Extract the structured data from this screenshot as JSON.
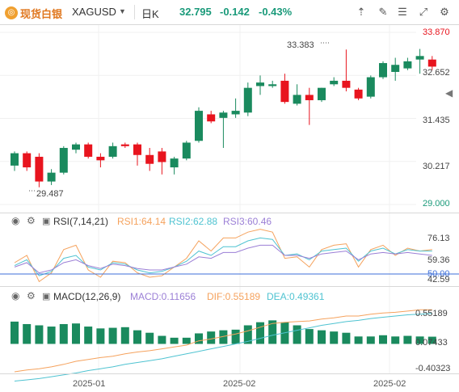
{
  "header": {
    "brand": "现货白银",
    "symbol": "XAGUSD",
    "period": "日K",
    "price": "32.795",
    "change": "-0.142",
    "change_pct": "-0.43%",
    "icons": [
      "arrow-up-icon",
      "edit-icon",
      "list-icon",
      "expand-icon",
      "settings-icon"
    ]
  },
  "main_axis": [
    "33.870",
    "32.652",
    "31.435",
    "30.217",
    "29.000"
  ],
  "annotations": {
    "high": "33.383",
    "low": "29.487"
  },
  "rsi": {
    "title": "RSI(7,14,21)",
    "rsi1": "RSI1:64.14",
    "rsi2": "RSI2:62.88",
    "rsi3": "RSI3:60.46",
    "axis": [
      "76.13",
      "59.36",
      "50.00",
      "42.59"
    ]
  },
  "macd": {
    "title": "MACD(12,26,9)",
    "macd": "MACD:0.11656",
    "dif": "DIF:0.55189",
    "dea": "DEA:0.49361",
    "axis": [
      "0.55189",
      "0.07433",
      "-0.40323"
    ]
  },
  "x_axis": [
    "2025-01",
    "2025-02",
    "2025-02"
  ],
  "colors": {
    "up": "#1a8a5e",
    "down": "#e8141e",
    "rsi1": "#f5a25d",
    "rsi2": "#4fc3d1",
    "rsi3": "#9b7fd6",
    "dif": "#f5a25d",
    "dea": "#4fc3d1"
  },
  "chart_data": {
    "type": "candlestick",
    "ylim": [
      29.0,
      33.87
    ],
    "candles": [
      {
        "o": 30.1,
        "h": 30.5,
        "l": 29.95,
        "c": 30.45
      },
      {
        "o": 30.45,
        "h": 30.5,
        "l": 29.95,
        "c": 30.05
      },
      {
        "o": 30.35,
        "h": 30.45,
        "l": 29.487,
        "c": 29.65
      },
      {
        "o": 29.65,
        "h": 30.0,
        "l": 29.55,
        "c": 29.9
      },
      {
        "o": 29.9,
        "h": 30.65,
        "l": 29.85,
        "c": 30.6
      },
      {
        "o": 30.55,
        "h": 30.75,
        "l": 30.45,
        "c": 30.7
      },
      {
        "o": 30.7,
        "h": 30.75,
        "l": 30.3,
        "c": 30.35
      },
      {
        "o": 30.35,
        "h": 30.45,
        "l": 30.05,
        "c": 30.25
      },
      {
        "o": 30.35,
        "h": 30.75,
        "l": 30.3,
        "c": 30.65
      },
      {
        "o": 30.7,
        "h": 30.75,
        "l": 30.6,
        "c": 30.65
      },
      {
        "o": 30.7,
        "h": 30.75,
        "l": 30.1,
        "c": 30.4
      },
      {
        "o": 30.4,
        "h": 30.6,
        "l": 29.95,
        "c": 30.15
      },
      {
        "o": 30.5,
        "h": 30.6,
        "l": 29.85,
        "c": 30.2
      },
      {
        "o": 30.05,
        "h": 30.35,
        "l": 29.85,
        "c": 30.3
      },
      {
        "o": 30.3,
        "h": 30.8,
        "l": 30.25,
        "c": 30.75
      },
      {
        "o": 30.8,
        "h": 31.75,
        "l": 30.75,
        "c": 31.65
      },
      {
        "o": 31.55,
        "h": 31.65,
        "l": 31.3,
        "c": 31.35
      },
      {
        "o": 31.45,
        "h": 31.65,
        "l": 30.6,
        "c": 31.6
      },
      {
        "o": 31.55,
        "h": 32.0,
        "l": 31.45,
        "c": 31.65
      },
      {
        "o": 31.6,
        "h": 32.45,
        "l": 31.5,
        "c": 32.3
      },
      {
        "o": 32.35,
        "h": 32.65,
        "l": 32.1,
        "c": 32.45
      },
      {
        "o": 32.35,
        "h": 32.5,
        "l": 32.3,
        "c": 32.4
      },
      {
        "o": 32.5,
        "h": 32.7,
        "l": 31.85,
        "c": 31.9
      },
      {
        "o": 31.85,
        "h": 32.4,
        "l": 31.8,
        "c": 32.1
      },
      {
        "o": 32.1,
        "h": 32.3,
        "l": 31.25,
        "c": 31.95
      },
      {
        "o": 31.95,
        "h": 32.3,
        "l": 31.9,
        "c": 32.3
      },
      {
        "o": 32.4,
        "h": 32.6,
        "l": 32.35,
        "c": 32.5
      },
      {
        "o": 32.5,
        "h": 33.383,
        "l": 32.2,
        "c": 32.3
      },
      {
        "o": 32.25,
        "h": 32.3,
        "l": 31.95,
        "c": 32.0
      },
      {
        "o": 32.05,
        "h": 32.65,
        "l": 32.0,
        "c": 32.6
      },
      {
        "o": 32.6,
        "h": 33.05,
        "l": 32.55,
        "c": 33.0
      },
      {
        "o": 32.75,
        "h": 33.15,
        "l": 32.5,
        "c": 32.95
      },
      {
        "o": 32.85,
        "h": 33.15,
        "l": 32.8,
        "c": 33.05
      },
      {
        "o": 33.1,
        "h": 33.4,
        "l": 32.7,
        "c": 33.2
      },
      {
        "o": 33.1,
        "h": 33.2,
        "l": 32.8,
        "c": 32.9
      }
    ],
    "rsi1": [
      55,
      60,
      42,
      48,
      64,
      67,
      50,
      45,
      56,
      55,
      48,
      45,
      46,
      52,
      58,
      70,
      63,
      72,
      72,
      76,
      78,
      76,
      58,
      59,
      52,
      64,
      67,
      68,
      52,
      64,
      67,
      60,
      65,
      63,
      64
    ],
    "rsi2": [
      53,
      57,
      46,
      49,
      58,
      60,
      52,
      50,
      55,
      54,
      50,
      48,
      49,
      52,
      56,
      63,
      60,
      66,
      66,
      70,
      72,
      71,
      60,
      61,
      57,
      63,
      64,
      65,
      56,
      63,
      65,
      61,
      64,
      63,
      63
    ],
    "rsi3": [
      52,
      55,
      48,
      50,
      55,
      57,
      53,
      51,
      54,
      53,
      51,
      50,
      50,
      52,
      54,
      59,
      58,
      62,
      62,
      65,
      67,
      67,
      60,
      60,
      58,
      61,
      62,
      63,
      57,
      61,
      62,
      61,
      62,
      61,
      60
    ],
    "macd_hist": [
      0.36,
      0.32,
      0.3,
      0.28,
      0.32,
      0.33,
      0.28,
      0.25,
      0.26,
      0.27,
      0.22,
      0.18,
      0.13,
      0.1,
      0.1,
      0.17,
      0.2,
      0.22,
      0.23,
      0.3,
      0.35,
      0.38,
      0.35,
      0.3,
      0.24,
      0.22,
      0.2,
      0.18,
      0.12,
      0.12,
      0.14,
      0.12,
      0.13,
      0.12,
      0.11656
    ],
    "macd_dif": [
      -0.45,
      -0.42,
      -0.4,
      -0.37,
      -0.33,
      -0.28,
      -0.25,
      -0.22,
      -0.2,
      -0.16,
      -0.13,
      -0.11,
      -0.08,
      -0.05,
      -0.02,
      0.05,
      0.08,
      0.12,
      0.16,
      0.21,
      0.27,
      0.33,
      0.35,
      0.36,
      0.37,
      0.4,
      0.42,
      0.45,
      0.45,
      0.48,
      0.5,
      0.51,
      0.53,
      0.55,
      0.55189
    ],
    "macd_dea": [
      -0.6,
      -0.58,
      -0.56,
      -0.53,
      -0.5,
      -0.47,
      -0.43,
      -0.4,
      -0.37,
      -0.33,
      -0.3,
      -0.27,
      -0.24,
      -0.2,
      -0.16,
      -0.12,
      -0.08,
      -0.04,
      0.0,
      0.04,
      0.09,
      0.14,
      0.18,
      0.22,
      0.26,
      0.3,
      0.33,
      0.36,
      0.38,
      0.41,
      0.43,
      0.45,
      0.47,
      0.48,
      0.49361
    ],
    "rsi_range": [
      40,
      80
    ],
    "macd_range": [
      -0.45,
      0.75
    ]
  }
}
